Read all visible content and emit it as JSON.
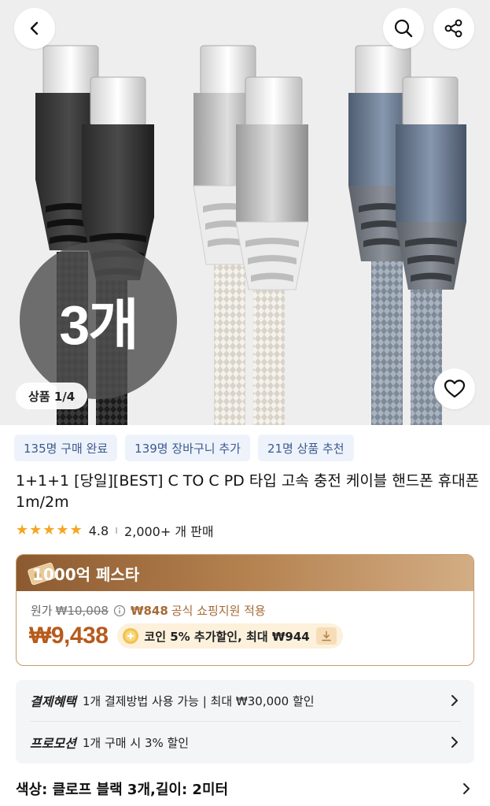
{
  "hero": {
    "qty_badge": "3개",
    "image_counter": "상품 1/4",
    "icons": [
      "back-icon",
      "search-icon",
      "share-icon",
      "heart-icon"
    ]
  },
  "stats": [
    {
      "label": "135명 구매 완료"
    },
    {
      "label": "139명 장바구니 추가"
    },
    {
      "label": "21명 상품 추천"
    }
  ],
  "product": {
    "title": "1+1+1 [당일][BEST] C TO C PD 타입 고속 충전 케이블 핸드폰 휴대폰 1m/2m",
    "rating": "4.8",
    "stars": 5,
    "sold": "2,000+ 개 판매"
  },
  "price": {
    "festival": "1000억 페스타",
    "original_label": "원가",
    "original_price": "₩10,008",
    "support_amount": "₩848",
    "support_text": "공식 쇼핑지원 적용",
    "sale_price": "₩9,438",
    "coin_text": "코인 5% 추가할인, 최대 ₩944"
  },
  "benefits": {
    "payment_label": "결제혜택",
    "payment_text": "1개 결제방법 사용 가능 | 최대 ₩30,000 할인",
    "promo_label": "프로모션",
    "promo_text": "1개 구매 시 3% 할인"
  },
  "option": {
    "text": "색상: 클로프 블랙 3개,길이: 2미터"
  },
  "colors": {
    "accent_price": "#b65b1c",
    "chip_bg": "#eef3fb",
    "chip_text": "#3b5a8e",
    "star": "#f5a623",
    "box_border": "#c79a6a"
  }
}
